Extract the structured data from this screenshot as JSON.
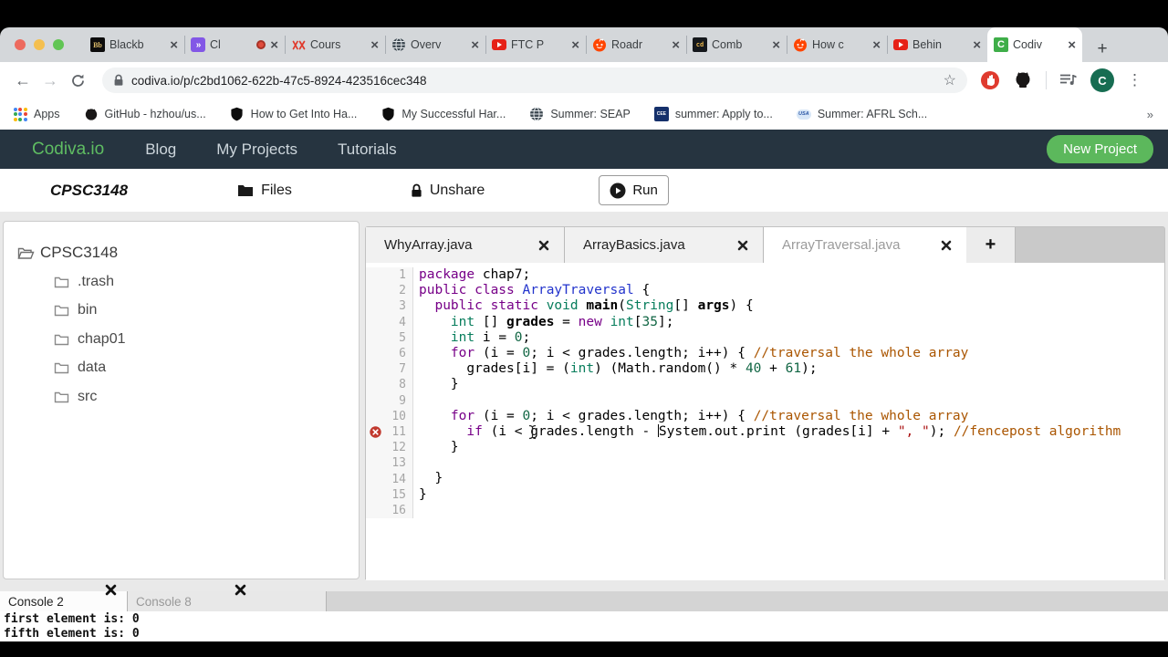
{
  "browser": {
    "tabs": [
      {
        "title": "Blackb",
        "icon": "blackboard"
      },
      {
        "title": "Cl",
        "icon": "screencastify",
        "recording": true
      },
      {
        "title": "Cours",
        "icon": "red-cjk"
      },
      {
        "title": "Overv",
        "icon": "globe"
      },
      {
        "title": "FTC P",
        "icon": "youtube"
      },
      {
        "title": "Roadr",
        "icon": "reddit"
      },
      {
        "title": "Comb",
        "icon": "cd"
      },
      {
        "title": "How c",
        "icon": "reddit"
      },
      {
        "title": "Behin",
        "icon": "youtube"
      },
      {
        "title": "Codiv",
        "icon": "codiva",
        "active": true
      }
    ],
    "glyphs": {
      "new_tab": "+",
      "close": "×",
      "back": "←",
      "forward": "→",
      "star": "☆",
      "menu": "⋮",
      "overflow": "»"
    },
    "address": {
      "url": "codiva.io/p/c2bd1062-622b-47c5-8924-423516cec348"
    },
    "profile_initial": "C",
    "bookmarks": [
      {
        "label": "Apps",
        "icon": "apps-grid"
      },
      {
        "label": "GitHub - hzhou/us...",
        "icon": "github"
      },
      {
        "label": "How to Get Into Ha...",
        "icon": "crest"
      },
      {
        "label": "My Successful Har...",
        "icon": "crest"
      },
      {
        "label": "Summer: SEAP",
        "icon": "globe"
      },
      {
        "label": "summer: Apply to...",
        "icon": "cee"
      },
      {
        "label": "Summer: AFRL Sch...",
        "icon": "usa"
      }
    ]
  },
  "navbar": {
    "brand": "Codiva.io",
    "links": [
      "Blog",
      "My Projects",
      "Tutorials"
    ],
    "new_project": "New Project",
    "bg_color": "#263440",
    "brand_color": "#5fbd62",
    "button_color": "#5cb85c"
  },
  "toolbar": {
    "project": "CPSC3148",
    "files": "Files",
    "unshare": "Unshare",
    "run": "Run"
  },
  "file_tree": {
    "root": "CPSC3148",
    "folders": [
      ".trash",
      "bin",
      "chap01",
      "data",
      "src"
    ]
  },
  "editor": {
    "tabs": [
      {
        "title": "WhyArray.java"
      },
      {
        "title": "ArrayBasics.java"
      },
      {
        "title": "ArrayTraversal.java",
        "active": true
      }
    ],
    "new_tab_label": "+",
    "error_line": 11,
    "lines": [
      {
        "n": 1,
        "seg": [
          [
            "k",
            "package"
          ],
          [
            "v",
            " chap7;"
          ]
        ]
      },
      {
        "n": 2,
        "seg": [
          [
            "k",
            "public class "
          ],
          [
            "cls",
            "ArrayTraversal"
          ],
          [
            "v",
            " {"
          ]
        ]
      },
      {
        "n": 3,
        "seg": [
          [
            "v",
            "  "
          ],
          [
            "k",
            "public static "
          ],
          [
            "t",
            "void "
          ],
          [
            "d",
            "main"
          ],
          [
            "v",
            "("
          ],
          [
            "t",
            "String"
          ],
          [
            "v",
            "[] "
          ],
          [
            "d",
            "args"
          ],
          [
            "v",
            ") {"
          ]
        ]
      },
      {
        "n": 4,
        "seg": [
          [
            "v",
            "    "
          ],
          [
            "t",
            "int"
          ],
          [
            "v",
            " [] "
          ],
          [
            "d",
            "grades"
          ],
          [
            "v",
            " = "
          ],
          [
            "k",
            "new"
          ],
          [
            "v",
            " "
          ],
          [
            "t",
            "int"
          ],
          [
            "v",
            "["
          ],
          [
            "n2",
            "35"
          ],
          [
            "v",
            "];"
          ]
        ]
      },
      {
        "n": 5,
        "seg": [
          [
            "v",
            "    "
          ],
          [
            "t",
            "int"
          ],
          [
            "v",
            " i = "
          ],
          [
            "n2",
            "0"
          ],
          [
            "v",
            ";"
          ]
        ]
      },
      {
        "n": 6,
        "seg": [
          [
            "v",
            "    "
          ],
          [
            "k",
            "for"
          ],
          [
            "v",
            " (i = "
          ],
          [
            "n2",
            "0"
          ],
          [
            "v",
            "; i < grades.length; i++) { "
          ],
          [
            "c",
            "//traversal the whole array"
          ]
        ]
      },
      {
        "n": 7,
        "seg": [
          [
            "v",
            "      grades[i] = ("
          ],
          [
            "t",
            "int"
          ],
          [
            "v",
            ") (Math.random() * "
          ],
          [
            "n2",
            "40"
          ],
          [
            "v",
            " + "
          ],
          [
            "n2",
            "61"
          ],
          [
            "v",
            ");"
          ]
        ]
      },
      {
        "n": 8,
        "seg": [
          [
            "v",
            "    }"
          ]
        ]
      },
      {
        "n": 9,
        "seg": []
      },
      {
        "n": 10,
        "seg": [
          [
            "v",
            "    "
          ],
          [
            "k",
            "for"
          ],
          [
            "v",
            " (i = "
          ],
          [
            "n2",
            "0"
          ],
          [
            "v",
            "; i < grades.length; i++) { "
          ],
          [
            "c",
            "//traversal the whole array"
          ]
        ]
      },
      {
        "n": 11,
        "seg": [
          [
            "v",
            "      "
          ],
          [
            "k",
            "if"
          ],
          [
            "v",
            " (i < grades.length - "
          ],
          [
            "caret",
            ""
          ],
          [
            "v",
            "System.out.print (grades[i] + "
          ],
          [
            "s",
            "\", \""
          ],
          [
            "v",
            "); "
          ],
          [
            "c",
            "//fencepost algorithm"
          ]
        ]
      },
      {
        "n": 12,
        "seg": [
          [
            "v",
            "    }"
          ]
        ]
      },
      {
        "n": 13,
        "seg": []
      },
      {
        "n": 14,
        "seg": [
          [
            "v",
            "  }"
          ]
        ]
      },
      {
        "n": 15,
        "seg": [
          [
            "v",
            "}"
          ]
        ]
      },
      {
        "n": 16,
        "seg": []
      }
    ],
    "syntax_colors": {
      "keyword": "#770088",
      "type": "#077d5c",
      "number": "#116644",
      "comment": "#aa5500",
      "string": "#aa1111",
      "classname": "#2233cc"
    }
  },
  "console": {
    "tabs": [
      {
        "title": "Console 2",
        "active": true
      },
      {
        "title": "Console 8"
      }
    ],
    "output": [
      "first element is: 0",
      "fifth element is: 0"
    ]
  }
}
